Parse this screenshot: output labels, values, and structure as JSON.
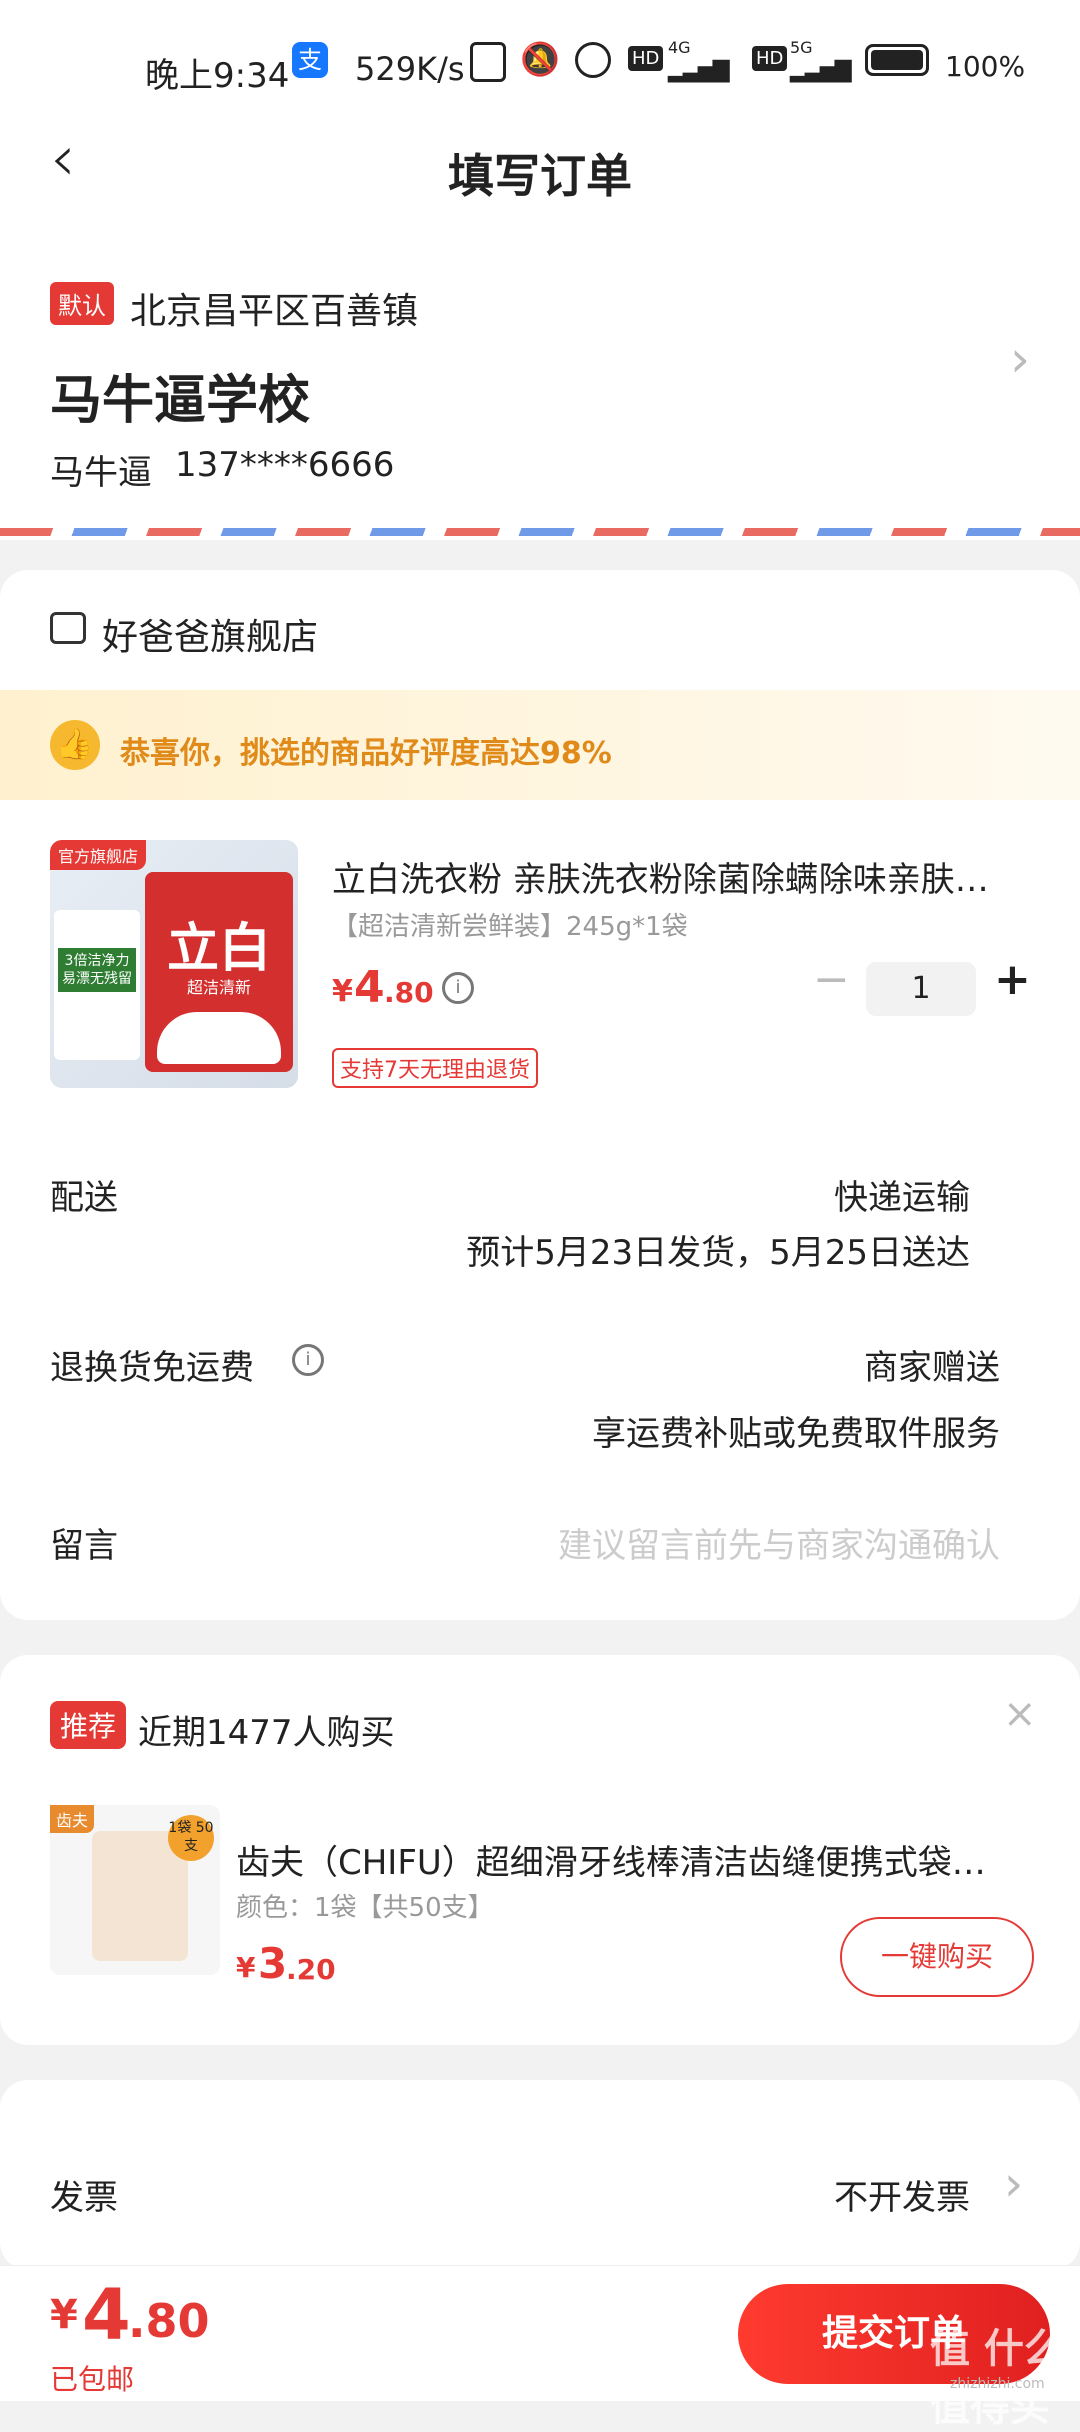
{
  "status_bar": {
    "time": "晚上9:34",
    "net_speed": "529K/s",
    "net1": "4G",
    "net2": "5G",
    "battery": "100%"
  },
  "header": {
    "title": "填写订单"
  },
  "address": {
    "default_badge": "默认",
    "region": "北京昌平区百善镇",
    "detail": "马牛逼学校",
    "contact_name": "马牛逼",
    "contact_phone": "137****6666"
  },
  "store": {
    "name": "好爸爸旗舰店"
  },
  "banner": {
    "text": "恭喜你，挑选的商品好评度高达98%"
  },
  "product": {
    "image_tag": "官方旗舰店",
    "image_brand": "立白",
    "image_sub": "超洁清新",
    "image_left_box": "3倍洁净力 易漂无残留",
    "title": "立白洗衣粉 亲肤洗衣粉除菌除螨除味亲肤…",
    "spec": "【超洁清新尝鲜装】245g*1袋",
    "price_symbol": "¥",
    "price_int": "4",
    "price_dec": ".80",
    "quantity": "1",
    "return_tag": "支持7天无理由退货"
  },
  "delivery": {
    "label": "配送",
    "method": "快递运输",
    "estimate": "预计5月23日发货，5月25日送达"
  },
  "return_fee": {
    "label": "退换货免运费",
    "value": "商家赠送",
    "desc": "享运费补贴或免费取件服务"
  },
  "message": {
    "label": "留言",
    "placeholder": "建议留言前先与商家沟通确认"
  },
  "recommend": {
    "badge": "推荐",
    "title": "近期1477人购买",
    "image_tag": "齿夫",
    "image_badge": "1袋 50支",
    "product_title": "齿夫（CHIFU）超细滑牙线棒清洁齿缝便携式袋…",
    "spec": "颜色：1袋【共50支】",
    "price_symbol": "¥",
    "price_int": "3",
    "price_dec": ".20",
    "buy_button": "一键购买"
  },
  "invoice": {
    "label": "发票",
    "value": "不开发票"
  },
  "footer": {
    "total_symbol": "¥",
    "total_int": "4",
    "total_dec": ".80",
    "shipping_note": "已包邮",
    "submit_button": "提交订单",
    "watermark": "值 什么值得买",
    "watermark_url": "zhizhizhi.com"
  },
  "colors": {
    "accent_red": "#e53935",
    "banner_bg": "#fff7e0",
    "banner_text": "#e08a1a"
  }
}
